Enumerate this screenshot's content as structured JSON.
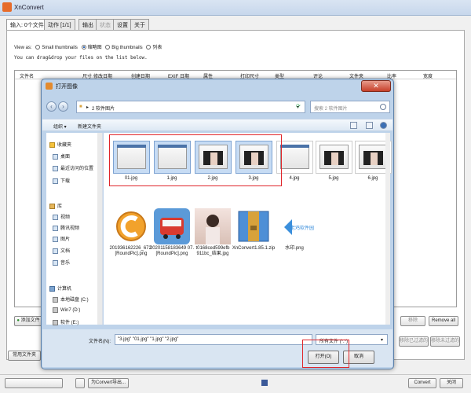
{
  "app": {
    "title": "XnConvert"
  },
  "tabs": [
    "输入: 0个文件",
    "动作 [1/1]",
    "输出",
    "状态",
    "设置",
    "关于"
  ],
  "view_as": {
    "label": "View as:",
    "options": [
      "Small thumbnails",
      "缩略图",
      "Big thumbnails",
      "列表"
    ],
    "selected": 1
  },
  "drag_hint": "You can drag&drop your files on the list below.",
  "list_columns": [
    "文件名",
    "尺寸",
    "修改日期",
    "创建日期",
    "EXIF 日期",
    "属性",
    "打印尺寸",
    "类型",
    "评论",
    "文件夹",
    "比率",
    "宽度"
  ],
  "buttons": {
    "add_file": "添加文件",
    "common_folder": "常用文件夹",
    "remove": "移除",
    "remove_all": "Remove all",
    "remove_filtered": "移除已过滤的",
    "remove_unfiltered": "移除未过滤的",
    "close": "关闭",
    "convert": "Convert"
  },
  "taskbar": {
    "task_label": "为Convert导出..."
  },
  "dialog": {
    "title": "打开图像",
    "close_glyph": "✕",
    "path": "2 软件图片",
    "search_placeholder": "搜索 2 软件图片",
    "organize": "组织 ▾",
    "new_folder": "新建文件夹",
    "nav": {
      "favorites": "收藏夹",
      "fav_items": [
        "桌面",
        "最近访问的位置",
        "下载"
      ],
      "library": "库",
      "lib_items": [
        "视频",
        "腾讯视频",
        "图片",
        "文档",
        "音乐"
      ],
      "computer": "计算机",
      "drives": [
        "本地磁盘 (C:)",
        "Win7 (D:)",
        "软件 (E:)"
      ]
    },
    "files": [
      {
        "name": "01.jpg"
      },
      {
        "name": "1.jpg"
      },
      {
        "name": "2.jpg"
      },
      {
        "name": "3.jpg"
      },
      {
        "name": "4.jpg"
      },
      {
        "name": "5.jpg"
      },
      {
        "name": "6.jpg"
      },
      {
        "name": "201936162226_672.[RoundPic].png"
      },
      {
        "name": "20201158183649 07.[RoundPic].png"
      },
      {
        "name": "t0168ced599efb 911bc_结果.jpg"
      },
      {
        "name": "XnConvert1.85.1.zip"
      },
      {
        "name": "水印.png"
      }
    ],
    "watermark_text": "老鸡软件园",
    "filename_label": "文件名(N):",
    "filename_value": "\"3.jpg\" \"01.jpg\" \"1.jpg\" \"2.jpg\"",
    "filter": "所有文件 (*.*)",
    "open_button": "打开(O)",
    "cancel_button": "取消"
  }
}
